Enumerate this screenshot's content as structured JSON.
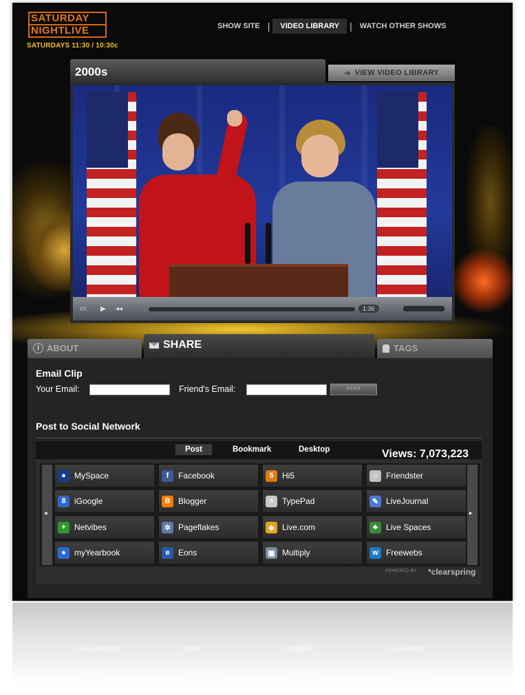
{
  "header": {
    "logo_line1": "SATURDAY",
    "logo_line2": "NIGHTLIVE",
    "showtimes": "SATURDAYS 11:30 / 10:30c",
    "nav": [
      "SHOW SITE",
      "VIDEO LIBRARY",
      "WATCH OTHER SHOWS"
    ],
    "nav_active": "VIDEO LIBRARY"
  },
  "video": {
    "title": "2000s",
    "view_library_label": "VIEW VIDEO LIBRARY",
    "time": "1:36"
  },
  "tabs": {
    "about": "ABOUT",
    "share": "SHARE",
    "tags": "TAGS",
    "active": "SHARE"
  },
  "share": {
    "email_heading": "Email Clip",
    "your_email_label": "Your Email:",
    "your_email_value": "",
    "friends_email_label": "Friend's Email:",
    "friends_email_value": "",
    "send_label": "SEND",
    "social_heading": "Post to Social Network",
    "widget_tabs": [
      "Post",
      "Bookmark",
      "Desktop"
    ],
    "widget_active_tab": "Post",
    "views": "Views: 7,073,223",
    "powered_by": "POWERED BY",
    "powered_brand": "clearspring",
    "networks": [
      {
        "label": "MySpace",
        "icon": "myspace-icon",
        "color": "#1a3a8a"
      },
      {
        "label": "Facebook",
        "icon": "facebook-icon",
        "color": "#3b5998"
      },
      {
        "label": "Hi5",
        "icon": "hi5-icon",
        "color": "#e07a10"
      },
      {
        "label": "Friendster",
        "icon": "friendster-icon",
        "color": "#c0c0c0"
      },
      {
        "label": "iGoogle",
        "icon": "igoogle-icon",
        "color": "#3366cc"
      },
      {
        "label": "Blogger",
        "icon": "blogger-icon",
        "color": "#f57d00"
      },
      {
        "label": "TypePad",
        "icon": "typepad-icon",
        "color": "#c8c8c8"
      },
      {
        "label": "LiveJournal",
        "icon": "livejournal-icon",
        "color": "#4a7ad0"
      },
      {
        "label": "Netvibes",
        "icon": "netvibes-icon",
        "color": "#2a9a2a"
      },
      {
        "label": "Pageflakes",
        "icon": "pageflakes-icon",
        "color": "#5a7aa8"
      },
      {
        "label": "Live.com",
        "icon": "live-com-icon",
        "color": "#e8a020"
      },
      {
        "label": "Live Spaces",
        "icon": "live-spaces-icon",
        "color": "#3a8a3a"
      },
      {
        "label": "myYearbook",
        "icon": "myyearbook-icon",
        "color": "#2a6ad8"
      },
      {
        "label": "Eons",
        "icon": "eons-icon",
        "color": "#2a5aaa"
      },
      {
        "label": "Multiply",
        "icon": "multiply-icon",
        "color": "#7a8aa8"
      },
      {
        "label": "Freewebs",
        "icon": "freewebs-icon",
        "color": "#1a7ac8"
      }
    ]
  },
  "colors": {
    "logo_orange": "#e0781e",
    "showtime_yellow": "#f2c21a",
    "panel_dark": "#242424"
  }
}
